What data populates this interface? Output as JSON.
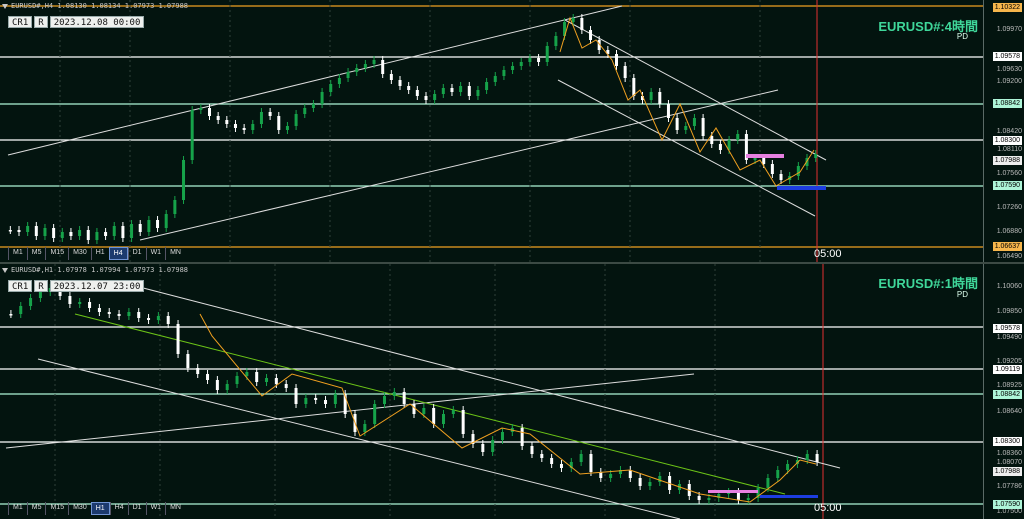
{
  "top": {
    "header": "EURUSD#,H4  1.08130 1.08134 1.07973 1.07988",
    "crosshair_buttons": [
      "CR1",
      "R"
    ],
    "date": "2023.12.08 00:00",
    "symbol_title": "EURUSD#:4時間",
    "pd": "PD",
    "timeframes": [
      "M1",
      "M5",
      "M15",
      "M30",
      "H1",
      "H4",
      "D1",
      "W1",
      "MN"
    ],
    "active_timeframe": "H4",
    "time_label": "05:00",
    "axis_ticks": [
      "1.09970",
      "1.09630",
      "1.09200",
      "1.08420",
      "1.08110",
      "1.07560",
      "1.07260",
      "1.06880",
      "1.06490"
    ],
    "tags": {
      "high": "1.10322",
      "r1": "1.09578",
      "r2": "1.08842",
      "r3": "1.08300",
      "current": "1.07988",
      "s1": "1.07590",
      "low": "1.06637"
    }
  },
  "bottom": {
    "header": "EURUSD#,H1  1.07978 1.07994 1.07973 1.07988",
    "crosshair_buttons": [
      "CR1",
      "R"
    ],
    "date": "2023.12.07 23:00",
    "symbol_title": "EURUSD#:1時間",
    "pd": "PD",
    "timeframes": [
      "M1",
      "M5",
      "M15",
      "M30",
      "H1",
      "H4",
      "D1",
      "W1",
      "MN"
    ],
    "active_timeframe": "H1",
    "time_label": "05:00",
    "axis_ticks": [
      "1.10060",
      "1.09850",
      "1.09490",
      "1.09205",
      "1.08925",
      "1.08640",
      "1.08360",
      "1.08070",
      "1.07786",
      "1.07500"
    ],
    "tags": {
      "r1": "1.09578",
      "r1b": "1.09119",
      "r2": "1.08842",
      "r3": "1.08300",
      "current": "1.07988",
      "s1": "1.07590"
    }
  },
  "colors": {
    "background": "#03140f",
    "bull": "#16a34a",
    "bear": "#ffffff",
    "level_green": "#aef5d8",
    "level_white": "#ffffff",
    "pink": "#e680e0",
    "blue": "#1d3de0",
    "orange": "#f0a020",
    "vline": "#e03030"
  }
}
